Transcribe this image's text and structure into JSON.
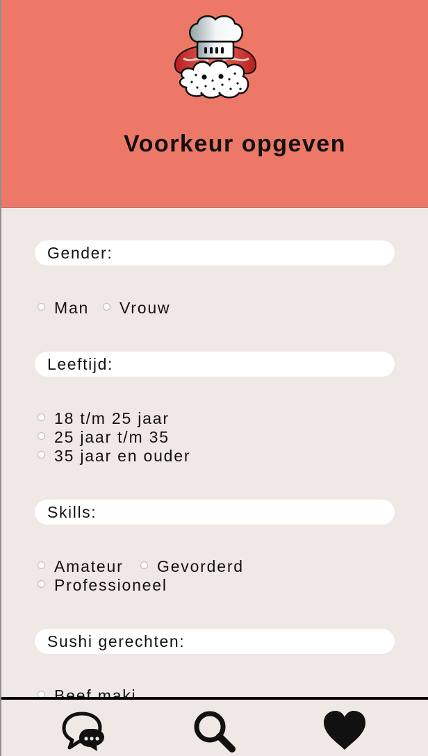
{
  "header": {
    "title": "Voorkeur opgeven",
    "logo_icon": "sushi-chef-logo"
  },
  "sections": {
    "gender": {
      "label": "Gender:",
      "options": [
        "Man",
        "Vrouw"
      ]
    },
    "age": {
      "label": "Leeftijd:",
      "options": [
        "18 t/m 25 jaar",
        "25 jaar t/m 35",
        "35 jaar en ouder"
      ]
    },
    "skills": {
      "label": "Skills:",
      "options": [
        "Amateur",
        "Gevorderd",
        "Professioneel"
      ]
    },
    "sushi": {
      "label": "Sushi gerechten:",
      "options": [
        "Beef maki"
      ]
    }
  },
  "nav": {
    "items": [
      {
        "icon": "chat-bubbles-icon"
      },
      {
        "icon": "search-icon"
      },
      {
        "icon": "heart-icon"
      }
    ]
  },
  "colors": {
    "header_bg": "#ee7867",
    "page_bg": "#efe8e4",
    "label_bg": "#ffffff",
    "text": "#111111"
  }
}
